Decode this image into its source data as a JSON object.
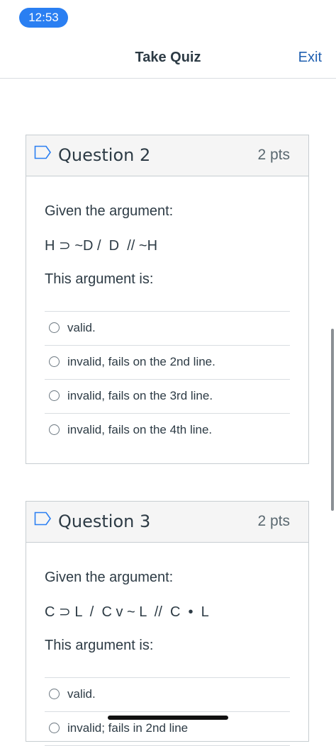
{
  "status": {
    "time": "12:53"
  },
  "nav": {
    "title": "Take Quiz",
    "exit_label": "Exit"
  },
  "questions": [
    {
      "title": "Question 2",
      "points": "2 pts",
      "prompt": "Given the argument:",
      "formula": "H ⊃ ~D /  D  // ~H",
      "after": "This argument is:",
      "answers": [
        "valid.",
        "invalid, fails on the 2nd line.",
        "invalid, fails on the 3rd line.",
        "invalid, fails on the 4th line."
      ]
    },
    {
      "title": "Question 3",
      "points": "2 pts",
      "prompt": "Given the argument:",
      "formula": "C ⊃ L  /  C v ~ L  //  C  •  L",
      "after": "This argument is:",
      "answers": [
        "valid.",
        "invalid; fails in 2nd line"
      ]
    }
  ]
}
